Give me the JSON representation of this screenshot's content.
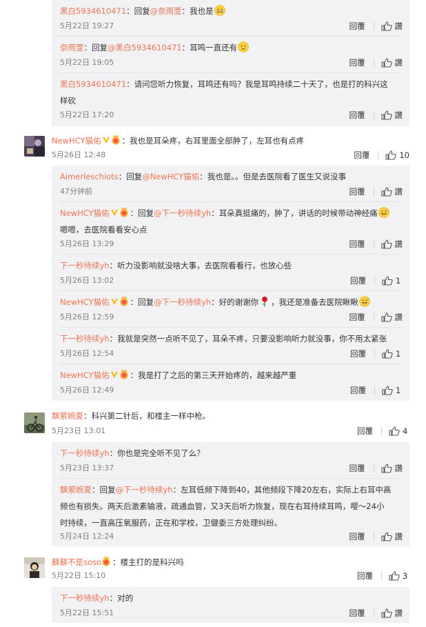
{
  "emoji": {
    "sad": "😢",
    "meh": "😶",
    "sweat": "😅",
    "rose": "🌹"
  },
  "reply_label": "回覆",
  "like_placeholder": "讚",
  "comments": [
    {
      "user": "黑白5934610471",
      "reply_word": "回复",
      "mention": "@奈雨萱",
      "text": "我也是",
      "time": "5月22日 19:27"
    },
    {
      "user": "奈雨萱",
      "reply_word": "回复",
      "mention": "@黑白5934610471",
      "text": "耳鸣一直还有",
      "time": "5月22日 19:05"
    },
    {
      "user": "黑白5934610471",
      "text_line1": "请问您听力恢复，耳鸣还有吗？我是耳鸣持续二十天了，也是打的科兴这",
      "text_line2": "样砍",
      "time": "5月22日 17:20"
    },
    {
      "user": "NewHCY猫佑",
      "text": "我也是耳朵疼，右耳里面全部肿了，左耳也有点疼",
      "time": "5月26日 12:48",
      "likes": "10"
    },
    {
      "user": "Aimerleschiots",
      "reply_word": "回复",
      "mention": "@NewHCY猫佑",
      "text": "我也是。。但是去医院看了医生又说没事",
      "time": "47分钟前"
    },
    {
      "user": "NewHCY猫佑",
      "reply_word": "回复",
      "mention": "@下一秒待续yh",
      "text_line1": "耳朵真挺痛的，肿了，讲话的时候带动神经痛",
      "text_line2": "嗯嗯，去医院看看安心点",
      "time": "5月26日 13:29"
    },
    {
      "user": "下一秒待续yh",
      "text": "听力没影响就没啥大事，去医院看看行，也放心些",
      "time": "5月26日 13:02",
      "likes": "1"
    },
    {
      "user": "NewHCY猫佑",
      "reply_word": "回复",
      "mention": "@下一秒待续yh",
      "text_a": "好的谢谢你",
      "text_b": "，我还是准备去医院瞅瞅",
      "time": "5月26日 12:59"
    },
    {
      "user": "下一秒待续yh",
      "text": "我就是突然一点听不见了，耳朵不疼，只要没影响听力就没事，你不用太紧张",
      "time": "5月26日 12:54",
      "likes": "1"
    },
    {
      "user": "NewHCY猫佑",
      "text": "我是打了之后的第三天开始疼的，越来越严重",
      "time": "5月26日 12:49",
      "likes": "1"
    },
    {
      "user": "飘萦婉夏",
      "text": "科兴第二针后，和楼主一样中枪。",
      "time": "5月23日 13:01",
      "likes": "4"
    },
    {
      "user": "下一秒待续yh",
      "text": "你也是完全听不见了么？",
      "time": "5月23日 13:37"
    },
    {
      "user": "飘萦婉夏",
      "reply_word": "回复",
      "mention": "@下一秒待续yh",
      "text_line1": "左耳低频下降到40，其他频段下降20左右，实际上右耳中高",
      "text_line2": "频也有损失。两天后激素输液，疏通血管，又3天后听力恢复，现在右耳持续耳鸣，嘤～24小",
      "text_line3": "时持续，一直高压氧服药，正在和学校，卫健委三方处理纠纷。",
      "time": "5月24日 12:24"
    },
    {
      "user": "蘇蘇不是soso",
      "text": "楼主打的是科兴吗",
      "time": "5月22日 15:10",
      "likes": "3"
    },
    {
      "user": "下一秒待续yh",
      "text": "对的",
      "time": "5月22日 15:51"
    }
  ]
}
